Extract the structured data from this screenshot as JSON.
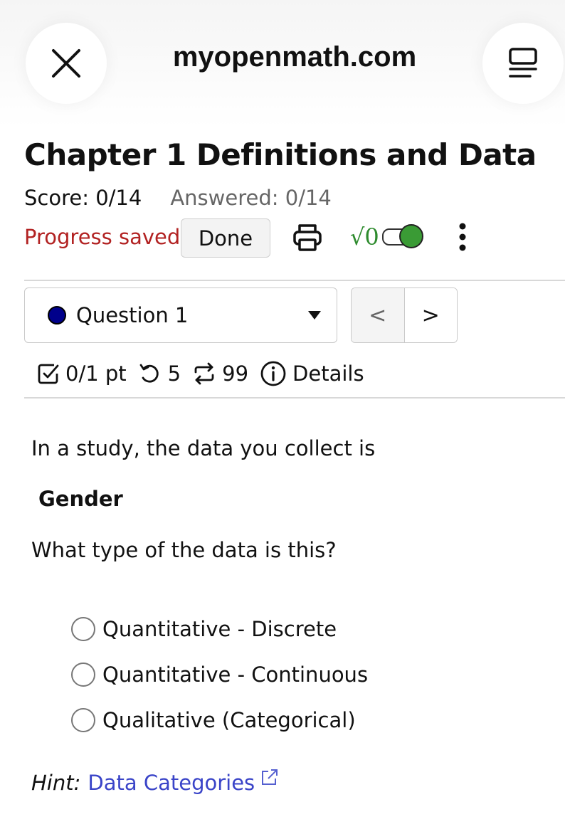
{
  "browser": {
    "site": "myopenmath.com",
    "close_icon": "close-icon",
    "reader_icon": "reader-mode-icon"
  },
  "assessment": {
    "title": "Chapter 1 Definitions and Data",
    "score": "Score: 0/14",
    "answered": "Answered: 0/14",
    "status": "Progress saved",
    "done_label": "Done",
    "math_toggle_label": "√0",
    "math_toggle_on": true
  },
  "question_nav": {
    "selected": "Question 1",
    "prev": "<",
    "next": ">"
  },
  "question_meta": {
    "points": "0/1 pt",
    "retries": "5",
    "regens": "99",
    "details": "Details"
  },
  "question": {
    "prompt": "In a study, the data you collect is",
    "data_value": "Gender",
    "ask": "What type of the data is this?",
    "choices": [
      "Quantitative - Discrete",
      "Quantitative - Continuous",
      "Qualitative (Categorical)"
    ],
    "hint_label": "Hint:",
    "hint_link": "Data Categories"
  },
  "colors": {
    "status_red": "#b22222",
    "link_blue": "#3a44c8",
    "toggle_green": "#3a9b35",
    "question_dot": "#00008b"
  }
}
